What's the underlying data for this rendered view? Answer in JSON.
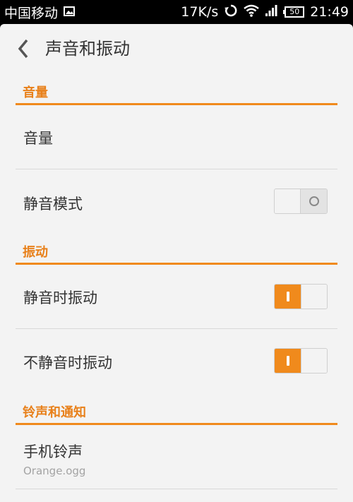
{
  "status_bar": {
    "carrier": "中国移动",
    "net_speed": "17K/s",
    "battery": "50",
    "time": "21:49",
    "icons": [
      "gallery-icon",
      "sync-icon",
      "wifi-icon",
      "signal-icon",
      "battery-icon"
    ]
  },
  "header": {
    "title": "声音和振动",
    "back_icon": "chevron-left-icon"
  },
  "sections": {
    "volume": {
      "title": "音量",
      "items": {
        "volume": "音量",
        "silent_mode": "静音模式"
      }
    },
    "vibration": {
      "title": "振动",
      "items": {
        "vibrate_silent": "静音时振动",
        "vibrate_not_silent": "不静音时振动"
      }
    },
    "ringtones": {
      "title": "铃声和通知",
      "items": {
        "phone_ringtone": "手机铃声",
        "phone_ringtone_value": "Orange.ogg"
      }
    }
  },
  "toggles": {
    "silent_mode": false,
    "vibrate_silent": true,
    "vibrate_not_silent": true
  },
  "colors": {
    "accent": "#f08a1c",
    "background": "#f3f3f3",
    "text": "#333333",
    "subtext": "#a3a3a3"
  }
}
